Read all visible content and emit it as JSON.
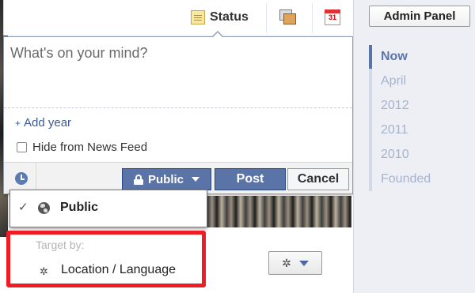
{
  "composer": {
    "tabs": {
      "status_label": "Status",
      "event_day": "31"
    },
    "placeholder": "What's on your mind?",
    "add_year_plus": "+",
    "add_year_label": "Add year",
    "hide_from_feed_label": "Hide from News Feed",
    "privacy_button_label": "Public",
    "post_label": "Post",
    "cancel_label": "Cancel"
  },
  "privacy_menu": {
    "check_glyph": "✓",
    "public_label": "Public",
    "target_heading": "Target by:",
    "location_label": "Location / Language",
    "location_icon_glyph": "✲"
  },
  "settings_dropdown": {
    "icon_glyph": "✲"
  },
  "sidebar": {
    "admin_panel_label": "Admin Panel",
    "timeline": [
      {
        "label": "Now",
        "active": true
      },
      {
        "label": "April",
        "active": false
      },
      {
        "label": "2012",
        "active": false
      },
      {
        "label": "2011",
        "active": false
      },
      {
        "label": "2010",
        "active": false
      },
      {
        "label": "Founded",
        "active": false
      }
    ]
  },
  "colors": {
    "brand_blue": "#5b74a8",
    "highlight_red": "#ee1c24",
    "link_blue": "#3b5998"
  },
  "icons": [
    "status-icon",
    "photo-icon",
    "event-calendar-icon",
    "clock-icon",
    "lock-icon",
    "globe-icon",
    "gear-icon",
    "chevron-down-icon"
  ]
}
